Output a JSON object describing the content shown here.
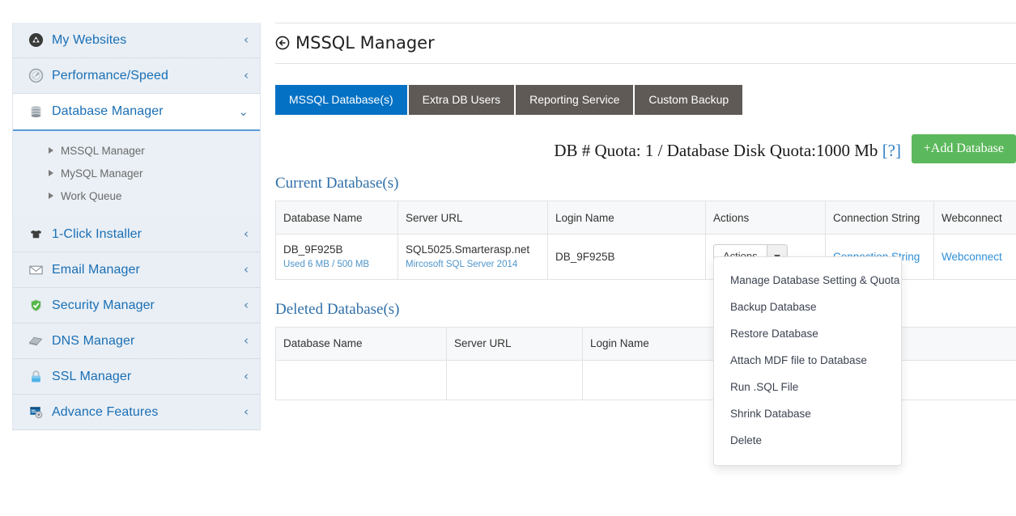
{
  "sidebar": {
    "items": [
      {
        "label": "My Websites",
        "icon": "globe-badge-icon",
        "chevron": "‹",
        "expanded": false
      },
      {
        "label": "Performance/Speed",
        "icon": "speedometer-icon",
        "chevron": "‹",
        "expanded": false
      },
      {
        "label": "Database Manager",
        "icon": "database-stack-icon",
        "chevron": "⌄",
        "expanded": true
      },
      {
        "label": "1-Click Installer",
        "icon": "tshirt-icon",
        "chevron": "‹",
        "expanded": false
      },
      {
        "label": "Email Manager",
        "icon": "envelope-icon",
        "chevron": "‹",
        "expanded": false
      },
      {
        "label": "Security Manager",
        "icon": "shield-check-icon",
        "chevron": "‹",
        "expanded": false
      },
      {
        "label": "DNS Manager",
        "icon": "dns-card-icon",
        "chevron": "‹",
        "expanded": false
      },
      {
        "label": "SSL Manager",
        "icon": "padlock-icon",
        "chevron": "‹",
        "expanded": false
      },
      {
        "label": "Advance Features",
        "icon": "gear-window-icon",
        "chevron": "‹",
        "expanded": false
      }
    ],
    "submenu": [
      {
        "label": "MSSQL Manager"
      },
      {
        "label": "MySQL Manager"
      },
      {
        "label": "Work Queue"
      }
    ]
  },
  "header": {
    "title": "MSSQL Manager",
    "icon": "target-left-arrow-icon"
  },
  "tabs": [
    {
      "label": "MSSQL Database(s)",
      "active": true
    },
    {
      "label": "Extra DB Users",
      "active": false
    },
    {
      "label": "Reporting Service",
      "active": false
    },
    {
      "label": "Custom Backup",
      "active": false
    }
  ],
  "quota": {
    "text": "DB # Quota: 1  / Database Disk Quota:1000 Mb ",
    "help": "[?]",
    "add_button": "+Add Database"
  },
  "current_section": {
    "title": "Current Database(s)",
    "columns": [
      "Database Name",
      "Server URL",
      "Login Name",
      "Actions",
      "Connection String",
      "Webconnect"
    ],
    "rows": [
      {
        "database_name": "DB_9F925B",
        "database_usage": "Used 6 MB / 500 MB",
        "server_url": "SQL5025.Smarterasp.net",
        "server_version": "Mircosoft SQL Server 2014",
        "login_name": "DB_9F925B",
        "actions_label": "Actions",
        "connection_string": "Connection String",
        "webconnect": "Webconnect"
      }
    ]
  },
  "deleted_section": {
    "title": "Deleted Database(s)",
    "columns": [
      "Database Name",
      "Server URL",
      "Login Name",
      "",
      ""
    ],
    "rows": [
      {
        "database_name": "",
        "server_url": "",
        "login_name": "",
        "c4": "",
        "c5": ""
      }
    ]
  },
  "actions_menu": {
    "open": true,
    "items": [
      "Manage Database Setting & Quota",
      "Backup Database",
      "Restore Database",
      "Attach MDF file to Database",
      "Run .SQL File",
      "Shrink Database",
      "Delete"
    ]
  },
  "colors": {
    "tab_active": "#0471c4",
    "tab_inactive": "#5f5a56",
    "add_button": "#5cb85c",
    "link": "#2f8fd8",
    "sidebar_bg": "#e9eff5",
    "sidebar_link": "#1a6fb5",
    "section_title": "#2f6fa8"
  }
}
